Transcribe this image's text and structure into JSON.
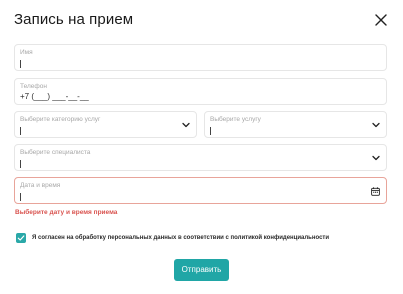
{
  "modal": {
    "title": "Запись на прием"
  },
  "fields": {
    "name": {
      "label": "Имя",
      "value": ""
    },
    "phone": {
      "label": "Телефон",
      "value": "+7 (___) ___-__-__"
    },
    "category": {
      "label": "Выберите категорию услуг",
      "value": ""
    },
    "service": {
      "label": "Выберите услугу",
      "value": ""
    },
    "specialist": {
      "label": "Выберите специалиста",
      "value": ""
    },
    "datetime": {
      "label": "Дата и время",
      "value": ""
    }
  },
  "error": {
    "datetime": "Выберите дату и время приема"
  },
  "consent": {
    "checked": true,
    "text": "Я согласен на обработку персональных данных в соответствии с политикой конфиденциальности"
  },
  "submit": {
    "label": "Отправить"
  },
  "colors": {
    "accent": "#20a6a6",
    "error": "#d9534f",
    "error_border": "#e8a49a",
    "border": "#e6e6e6"
  },
  "icons": {
    "close": "close-icon",
    "dropdown": "chevron-down-icon",
    "calendar": "calendar-icon",
    "check": "check-icon"
  }
}
